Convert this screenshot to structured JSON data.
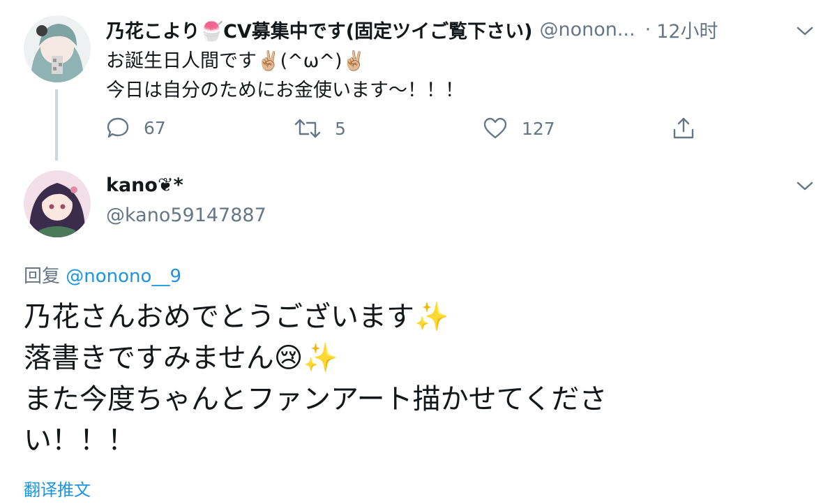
{
  "parent_tweet": {
    "display_name": "乃花こより🍧CV募集中です(固定ツイご覧下さい)",
    "handle": "@nonon...",
    "separator": "·",
    "time": "12小时",
    "text_lines": [
      "お誕生日人間です✌🏼(^ω^)✌🏼",
      "今日は自分のためにお金使います〜！！！"
    ],
    "actions": {
      "reply_count": "67",
      "retweet_count": "5",
      "like_count": "127"
    },
    "icons": [
      "reply-icon",
      "retweet-icon",
      "like-icon",
      "share-icon",
      "chevron-down-icon"
    ]
  },
  "reply_tweet": {
    "display_name": "kano❦*",
    "handle": "@kano59147887",
    "replying_label": "回复",
    "replying_to": "@nonono__9",
    "text_lines": [
      "乃花さんおめでとうございます✨",
      "落書きですみません😢✨",
      "また今度ちゃんとファンアート描かせてくださ",
      "い！！！"
    ],
    "translate_label": "翻译推文"
  },
  "colors": {
    "text": "#14171a",
    "secondary": "#657786",
    "link": "#1b95e0",
    "thread_line": "#ccd6dd"
  }
}
